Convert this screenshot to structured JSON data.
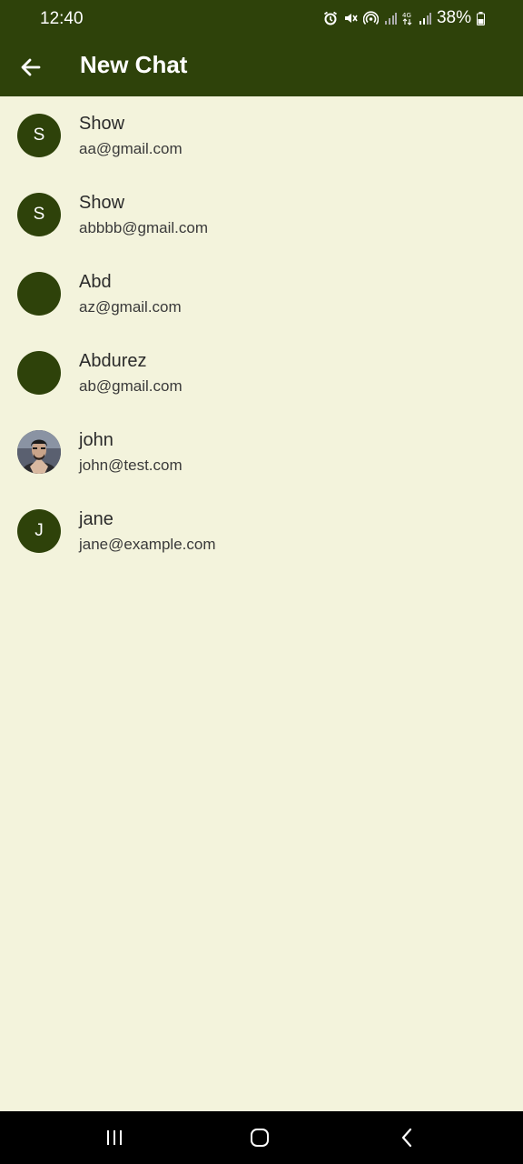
{
  "status_bar": {
    "time": "12:40",
    "battery": "38%",
    "icons": [
      "alarm-icon",
      "mute-icon",
      "hotspot-icon",
      "signal-icon",
      "4g-icon",
      "signal-icon",
      "battery-icon"
    ]
  },
  "header": {
    "title": "New Chat",
    "back_icon": "back-arrow-icon"
  },
  "contacts": [
    {
      "initial": "S",
      "name": "Show",
      "email": "aa@gmail.com"
    },
    {
      "initial": "S",
      "name": "Show",
      "email": "abbbb@gmail.com"
    },
    {
      "initial": "",
      "name": "Abd",
      "email": "az@gmail.com"
    },
    {
      "initial": "",
      "name": "Abdurez",
      "email": "ab@gmail.com"
    },
    {
      "initial": "",
      "name": "john",
      "email": "john@test.com",
      "photo": true
    },
    {
      "initial": "J",
      "name": "jane",
      "email": "jane@example.com"
    }
  ],
  "nav_bar": {
    "icons": [
      "recent-apps-icon",
      "home-icon",
      "back-icon"
    ]
  },
  "colors": {
    "primary": "#2e420a",
    "background": "#f3f3dc"
  }
}
